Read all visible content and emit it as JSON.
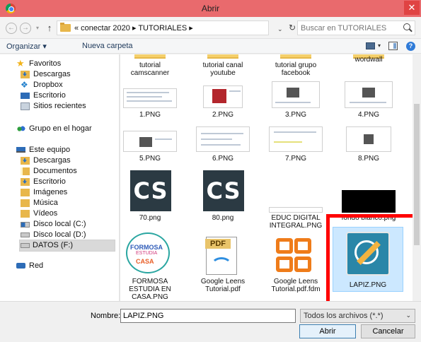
{
  "window": {
    "title": "Abrir",
    "close_glyph": "✕"
  },
  "nav": {
    "back_glyph": "←",
    "forward_glyph": "→",
    "dropdown_glyph": "▾",
    "up_glyph": "↑"
  },
  "address": {
    "breadcrumb": "« conectar 2020 ▸ TUTORIALES ▸",
    "dropdown_glyph": "⌄",
    "refresh_glyph": "↻"
  },
  "search": {
    "placeholder": "Buscar en TUTORIALES"
  },
  "toolbar": {
    "organize_label": "Organizar ▾",
    "new_folder_label": "Nueva carpeta",
    "view_dropdown_glyph": "▾",
    "help_glyph": "?"
  },
  "sidebar": {
    "items": [
      {
        "label": "Favoritos",
        "icon": "star-icon"
      },
      {
        "label": "Descargas",
        "icon": "downloads-folder-icon"
      },
      {
        "label": "Dropbox",
        "icon": "dropbox-icon"
      },
      {
        "label": "Escritorio",
        "icon": "desktop-icon"
      },
      {
        "label": "Sitios recientes",
        "icon": "recent-places-icon"
      },
      {
        "label": "Grupo en el hogar",
        "icon": "homegroup-icon"
      },
      {
        "label": "Este equipo",
        "icon": "computer-icon"
      },
      {
        "label": "Descargas",
        "icon": "downloads-folder-icon"
      },
      {
        "label": "Documentos",
        "icon": "documents-folder-icon"
      },
      {
        "label": "Escritorio",
        "icon": "desktop-folder-icon"
      },
      {
        "label": "Imágenes",
        "icon": "pictures-folder-icon"
      },
      {
        "label": "Música",
        "icon": "music-folder-icon"
      },
      {
        "label": "Vídeos",
        "icon": "videos-folder-icon"
      },
      {
        "label": "Disco local (C:)",
        "icon": "system-drive-icon"
      },
      {
        "label": "Disco local (D:)",
        "icon": "drive-icon"
      },
      {
        "label": "DATOS (F:)",
        "icon": "drive-icon"
      },
      {
        "label": "Red",
        "icon": "network-icon"
      }
    ]
  },
  "files": {
    "row1": [
      "tutorial camscanner",
      "tutorial canal youtube",
      "tutorial grupo facebook",
      "wordwall"
    ],
    "row2": [
      "1.PNG",
      "2.PNG",
      "3.PNG",
      "4.PNG"
    ],
    "row3": [
      "5.PNG",
      "6.PNG",
      "7.PNG",
      "8.PNG"
    ],
    "row4": [
      "70.png",
      "80.png",
      "EDUC DIGITAL INTEGRAL.PNG",
      "fondo blanco.png"
    ],
    "row5": [
      "FORMOSA ESTUDIA EN CASA.PNG",
      "Google Leens Tutorial.pdf",
      "Google Leens Tutorial.pdf.fdm",
      "LAPIZ.PNG"
    ],
    "cs_text": "CS",
    "pdf_tag": "PDF",
    "formosa_logo": [
      "FORMOSA",
      "ESTUDIA",
      "CASA"
    ]
  },
  "footer": {
    "name_label": "Nombre:",
    "name_value": "LAPIZ.PNG",
    "type_value": "Todos los archivos (*.*)",
    "type_dropdown_glyph": "⌄",
    "open_label": "Abrir",
    "cancel_label": "Cancelar"
  },
  "colors": {
    "titlebar": "#e96a6d",
    "close": "#e04343",
    "highlight": "#ff0000",
    "selection": "#cce8ff"
  }
}
